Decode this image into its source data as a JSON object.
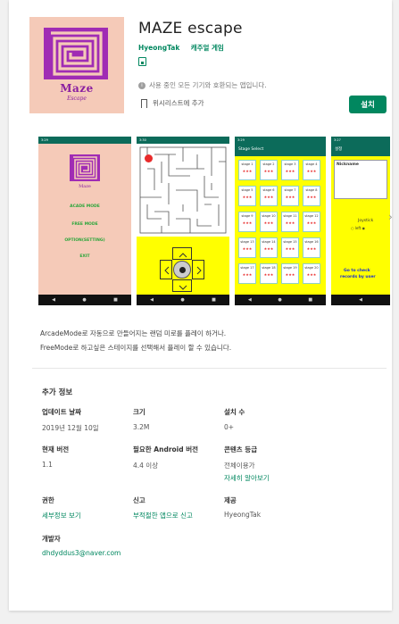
{
  "app": {
    "title": "MAZE escape",
    "developer": "HyeongTak",
    "category": "캐주얼 게임",
    "compat_text": "사용 중인 모든 기기와 호환되는 앱입니다.",
    "wishlist_label": "위시리스트에 추가",
    "install_label": "설치",
    "logo_title": "Maze",
    "logo_sub": "Escape"
  },
  "screenshots": {
    "s1": {
      "menu": [
        "ACADE MODE",
        "FREE MODE",
        "OPTION(SETTING)",
        "EXIT"
      ],
      "logo_title": "Maze",
      "logo_sub": "Escape"
    },
    "s3": {
      "header": "Stage Select",
      "stages": [
        "stage 1",
        "stage 2",
        "stage 3",
        "stage 4",
        "stage 5",
        "stage 6",
        "stage 7",
        "stage 8",
        "stage 9",
        "stage 10",
        "stage 11",
        "stage 12",
        "stage 13",
        "stage 14",
        "stage 15",
        "stage 16",
        "stage 17",
        "stage 18",
        "stage 19",
        "stage 20"
      ]
    },
    "s4": {
      "header": "설정",
      "nickname_label": "Nickname",
      "joystick_label": "Joystick",
      "left_label": "left",
      "bottom_text": "Go to check",
      "bottom_text2": "records by user"
    }
  },
  "description": {
    "line1": "ArcadeMode로 자동으로 만들어지는 랜덤 미로를 플레이 하거나.",
    "line2": "FreeMode로 하고싶은 스테이지를 선택해서 플레이 할 수 있습니다."
  },
  "additional_info": {
    "title": "추가 정보",
    "items": [
      {
        "label": "업데이트 날짜",
        "value": "2019년 12월 10일"
      },
      {
        "label": "크기",
        "value": "3.2M"
      },
      {
        "label": "설치 수",
        "value": "0+"
      },
      {
        "label": "현재 버전",
        "value": "1.1"
      },
      {
        "label": "필요한 Android 버전",
        "value": "4.4 이상"
      },
      {
        "label": "콘텐츠 등급",
        "value": "전체이용가",
        "link": "자세히 알아보기"
      },
      {
        "label": "권한",
        "link": "세부정보 보기"
      },
      {
        "label": "신고",
        "link": "부적절한 앱으로 신고"
      },
      {
        "label": "제공",
        "value": "HyeongTak"
      },
      {
        "label": "개발자",
        "link": "dhdyddus3@naver.com"
      }
    ]
  }
}
